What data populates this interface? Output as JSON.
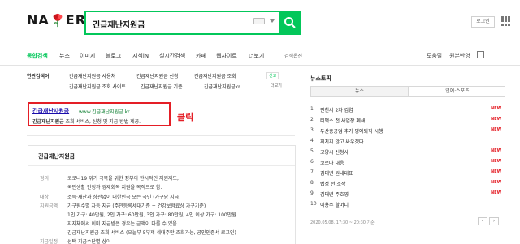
{
  "header": {
    "logo_left": "NA",
    "logo_right": "ER",
    "query": "긴급재난지원금",
    "login_label": "로그인"
  },
  "tabs": [
    {
      "label": "통합검색",
      "active": true
    },
    {
      "label": "뉴스"
    },
    {
      "label": "이미지"
    },
    {
      "label": "블로그"
    },
    {
      "label": "지식iN"
    },
    {
      "label": "실시간검색"
    },
    {
      "label": "카페"
    },
    {
      "label": "웹사이트"
    },
    {
      "label": "더보기"
    }
  ],
  "search_option_label": "검색옵션",
  "right_tabs": {
    "help": "도움말",
    "feedback": "원본반영"
  },
  "related": {
    "label": "연관검색어",
    "row1": [
      "긴급재난지원금 사용처",
      "긴급재난지원금 신청",
      "긴급재난지원금 조회"
    ],
    "row2": [
      "긴급재난지원금 조회 사이트",
      "긴급재난지원금 기준",
      "긴급재난지원금kr"
    ],
    "new_badge": "신고",
    "more_label": "더보기"
  },
  "ad": {
    "title": "긴급재난지원금",
    "url": "www.긴급재난지원금.kr",
    "desc_bold": "긴급재난지원금",
    "desc_rest": " 조회 서비스, 신청 및 지급 방법 제공."
  },
  "click_label": "클릭",
  "info": {
    "title": "긴급재난지원금",
    "rows": [
      {
        "label": "정의",
        "text": "코로나19 위기 극복을 위한 정부의 한시적인 지원제도,"
      },
      {
        "label": "",
        "text": "국민생활 안정과 경제회복 지원을 목적으로 함."
      },
      {
        "label": "대상",
        "text": "소득·재산과 상관없이 대한민국 모든 국민 (가구당 지급)"
      },
      {
        "label": "지원금액",
        "text": "가구원수별 차등 지급 (주민등록세대기준 + 건강보험료상 가구기준)"
      },
      {
        "label": "",
        "text": "1인 가구: 40만원, 2인 가구: 60만원, 3인 가구: 80만원, 4인 이상 가구: 100만원"
      },
      {
        "label": "",
        "text": "지자체에서 이미 지급받은 경우는 금액이 다를 수 있음."
      },
      {
        "label": "",
        "text": "긴급재난지원금 조회 서비스 (오늘부 5부제 세대주만 조회가능, 공인인증서 로그인)"
      },
      {
        "label": "지급일정",
        "text": "선택 지급수단별 상이"
      }
    ]
  },
  "news": {
    "title": "뉴스토픽",
    "tabs": [
      "뉴스",
      "연예·스포츠"
    ],
    "items": [
      {
        "num": "1",
        "text": "인천서 2차 감염",
        "badge": "NEW"
      },
      {
        "num": "2",
        "text": "티맥스 전 사업장 폐쇄",
        "badge": "NEW"
      },
      {
        "num": "3",
        "text": "두산중공업 추가 명예퇴직 시행",
        "badge": "NEW"
      },
      {
        "num": "4",
        "text": "지치지 않고 싸우겠다",
        "badge": ""
      },
      {
        "num": "5",
        "text": "고양시 신청사",
        "badge": "NEW"
      },
      {
        "num": "6",
        "text": "코로나 대응",
        "badge": "NEW"
      },
      {
        "num": "7",
        "text": "김태년 원내대표",
        "badge": "NEW"
      },
      {
        "num": "8",
        "text": "법정 선 조작",
        "badge": "NEW"
      },
      {
        "num": "9",
        "text": "김태년 주호영",
        "badge": "NEW"
      },
      {
        "num": "10",
        "text": "이용수 할머니",
        "badge": ""
      }
    ],
    "timestamp": "2020.05.08. 17:30 ~ 20:30 기준"
  }
}
